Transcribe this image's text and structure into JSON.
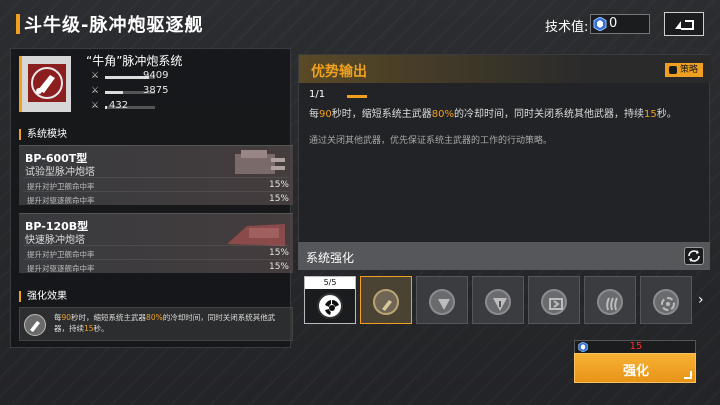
{
  "header": {
    "title": "斗牛级-脉冲炮驱逐舰",
    "tech_label": "技术值:",
    "tech_value": "0"
  },
  "weapon": {
    "name": "“牛角”脉冲炮系统",
    "stats": [
      {
        "icon": "attack-icon",
        "value": "9409",
        "level": 0.88
      },
      {
        "icon": "defense-icon",
        "value": "3875",
        "level": 0.36
      },
      {
        "icon": "speed-icon",
        "value": "432",
        "level": 0.04
      }
    ]
  },
  "modules": {
    "section_title": "系统模块",
    "items": [
      {
        "name": "BP-600T型",
        "desc": "试验型脉冲炮塔",
        "lines": [
          {
            "label": "提升对护卫舰命中率",
            "value": "15%"
          },
          {
            "label": "提升对驱逐舰命中率",
            "value": "15%"
          }
        ]
      },
      {
        "name": "BP-120B型",
        "desc": "快速脉冲炮塔",
        "lines": [
          {
            "label": "提升对护卫舰命中率",
            "value": "15%"
          },
          {
            "label": "提升对驱逐舰命中率",
            "value": "15%"
          }
        ]
      }
    ]
  },
  "effect": {
    "section_title": "强化效果",
    "text_parts": [
      "每",
      "90",
      "秒时，缩短系统主武器",
      "80%",
      "的冷却时间，同时关闭系统其他武器，持续",
      "15",
      "秒。"
    ]
  },
  "detail": {
    "title": "优势输出",
    "tag": "策略",
    "level": "1/1",
    "desc_parts": [
      "每",
      "90",
      "秒时，缩短系统主武器",
      "80%",
      "的冷却时间，同时关闭系统其他武器，持续",
      "15",
      "秒。"
    ],
    "note": "通过关闭其他武器，优先保证系统主武器的工作的行动策略。"
  },
  "enhance": {
    "title": "系统强化",
    "slot_count_label": "5/5",
    "slots": [
      "radiation-icon",
      "cannon-icon",
      "shield-icon",
      "shield-strike-icon",
      "armor-icon",
      "flames-icon",
      "vortex-icon"
    ],
    "cost": "15",
    "button_label": "强化"
  },
  "colors": {
    "accent": "#f0a020",
    "cost_red": "#ff3030"
  }
}
